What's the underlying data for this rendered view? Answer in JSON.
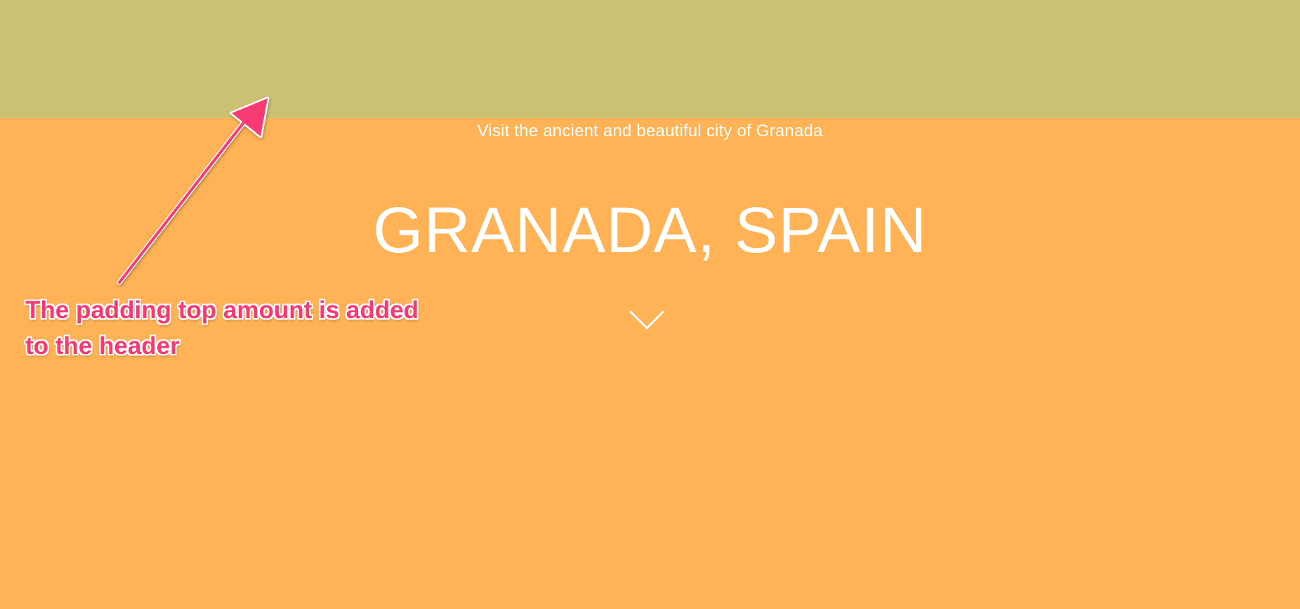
{
  "header": {
    "tagline": "Visit the ancient and beautiful city of Granada",
    "title": "GRANADA, SPAIN",
    "scroll_icon": "chevron-down-icon"
  },
  "annotation": {
    "text": "The padding top amount is added to the header",
    "color": "#f83a72"
  },
  "colors": {
    "padding_background": "#cbc172",
    "header_background": "#ffb356",
    "header_text": "#ffffff"
  }
}
